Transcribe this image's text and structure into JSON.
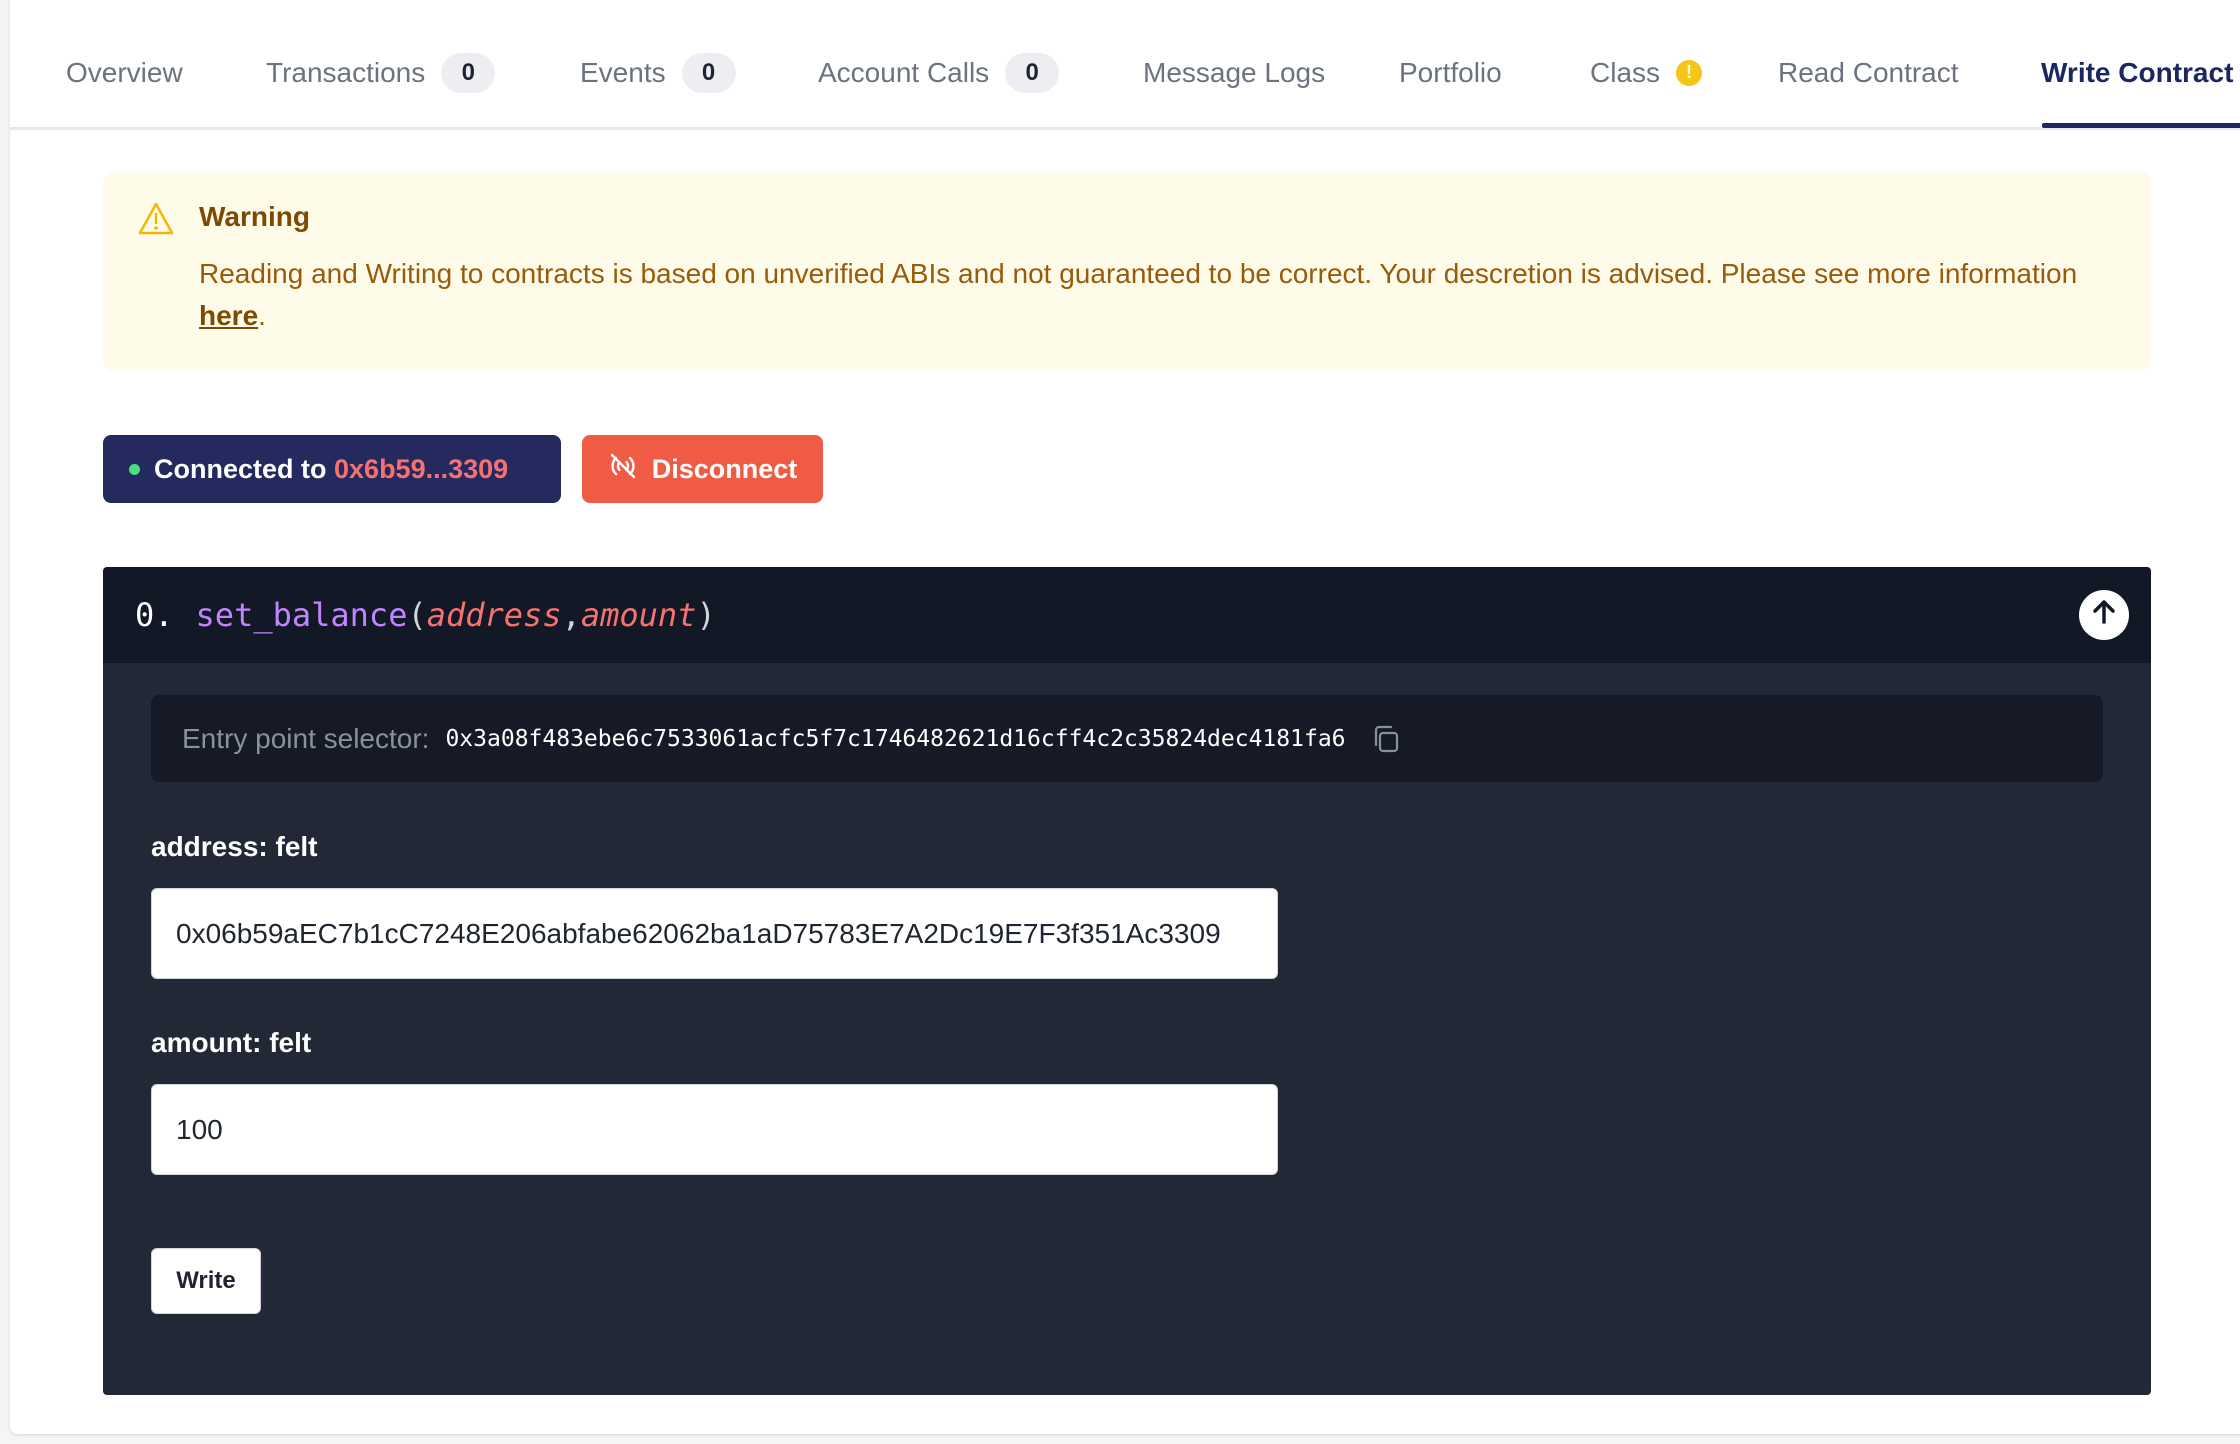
{
  "tabs": [
    {
      "label": "Overview"
    },
    {
      "label": "Transactions",
      "count": "0"
    },
    {
      "label": "Events",
      "count": "0"
    },
    {
      "label": "Account Calls",
      "count": "0"
    },
    {
      "label": "Message Logs"
    },
    {
      "label": "Portfolio"
    },
    {
      "label": "Class",
      "badge": "!"
    },
    {
      "label": "Read Contract"
    },
    {
      "label": "Write Contract",
      "active": true
    }
  ],
  "warning": {
    "title": "Warning",
    "text": "Reading and Writing to contracts is based on unverified ABIs and not guaranteed to be correct. Your descretion is advised. Please see more information",
    "link": "here",
    "suffix": "."
  },
  "wallet": {
    "connected_label": "Connected to",
    "address": "0x6b59...3309",
    "disconnect_label": "Disconnect"
  },
  "function": {
    "index": "0.",
    "name": "set_balance",
    "open_paren": "(",
    "arg1": "address",
    "comma": ", ",
    "arg2": "amount",
    "close_paren": ")",
    "selector_label": "Entry point selector:",
    "selector_value": "0x3a08f483ebe6c7533061acfc5f7c1746482621d16cff4c2c35824dec4181fa6",
    "inputs": [
      {
        "label": "address: felt",
        "value": "0x06b59aEC7b1cC7248E206abfabe62062ba1aD75783E7A2Dc19E7F3f351Ac3309"
      },
      {
        "label": "amount: felt",
        "value": "100"
      }
    ],
    "write_label": "Write"
  },
  "colors": {
    "accent": "#1c2761",
    "disconnect": "#ef5b45",
    "address_highlight": "#f87171",
    "function_name": "#c084fc"
  }
}
